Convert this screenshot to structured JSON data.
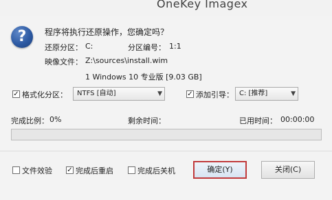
{
  "window": {
    "title": "OneKey Imagex"
  },
  "dialog": {
    "question": "程序将执行还原操作，您确定吗？",
    "restore_partition_label": "还原分区：",
    "restore_partition_value": "C:",
    "partition_number_label": "分区编号：",
    "partition_number_value": "1:1",
    "image_file_label": "映像文件：",
    "image_file_value": "Z:\\sources\\install.wim",
    "image_detail": "1 Windows 10 专业版 [9.03 GB]"
  },
  "options": {
    "format_label": "格式化分区：",
    "format_checked": true,
    "format_select_value": "NTFS [自动]",
    "boot_label": "添加引导：",
    "boot_checked": true,
    "boot_select_value": "C: [推荐]"
  },
  "progress": {
    "percent_label": "完成比例：",
    "percent_value": "0%",
    "percent_fraction": 0,
    "remaining_label": "剩余时间：",
    "remaining_value": "",
    "elapsed_label": "已用时间：",
    "elapsed_value": "00:00:00",
    "fill_color": "#2fa84f"
  },
  "footer": {
    "verify_label": "文件效验",
    "verify_checked": false,
    "reboot_label": "完成后重启",
    "reboot_checked": true,
    "shutdown_label": "完成后关机",
    "shutdown_checked": false,
    "ok_label": "确定(Y)",
    "close_label": "关闭(C)"
  },
  "icons": {
    "dialog_icon": "question-icon",
    "dropdown_icon": "chevron-down-icon"
  }
}
